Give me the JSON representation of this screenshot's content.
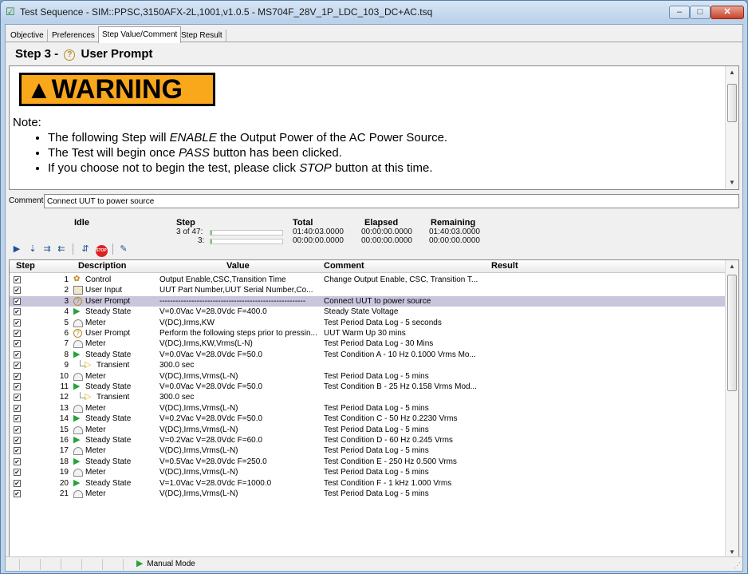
{
  "window": {
    "title": "Test Sequence - SIM::PPSC,3150AFX-2L,1001,v1.0.5 - MS704F_28V_1P_LDC_103_DC+AC.tsq",
    "app_icon": "checklist-icon",
    "buttons": {
      "minimize": "–",
      "maximize": "□",
      "close": "✕"
    }
  },
  "tabs": [
    {
      "label": "Objective"
    },
    {
      "label": "Preferences"
    },
    {
      "label": "Step Value/Comment",
      "active": true
    },
    {
      "label": "Step Result"
    }
  ],
  "step_heading": {
    "prefix": "Step 3 -",
    "label": "User Prompt",
    "icon": "question-icon"
  },
  "prompt": {
    "warning_text": "WARNING",
    "note_label": "Note:",
    "bullets": [
      {
        "pre": "The following Step will ",
        "em": "ENABLE",
        "post": " the Output Power of the AC Power Source."
      },
      {
        "pre": "The Test will begin once ",
        "em": "PASS",
        "post": " button has been clicked."
      },
      {
        "pre": "If you choose not to begin the test, please click ",
        "em": "STOP",
        "post": " button at this time."
      }
    ]
  },
  "comment": {
    "label": "Comment:",
    "value": "Connect UUT to power source"
  },
  "status": {
    "state": "Idle",
    "step_header": "Step",
    "total_header": "Total",
    "elapsed_header": "Elapsed",
    "remaining_header": "Remaining",
    "step_row1": "3 of 47:",
    "step_row2": "3:",
    "total_row1": "01:40:03.0000",
    "total_row2": "00:00:00.0000",
    "elapsed_row1": "00:00:00.0000",
    "elapsed_row2": "00:00:00.0000",
    "remaining_row1": "01:40:03.0000",
    "remaining_row2": "00:00:00.0000",
    "progress1": 0.02,
    "progress2": 0.02
  },
  "toolbar": [
    {
      "name": "run-icon",
      "glyph": "▶"
    },
    {
      "name": "step-into-icon",
      "glyph": "⇣"
    },
    {
      "name": "step-over-icon",
      "glyph": "⇉"
    },
    {
      "name": "step-out-icon",
      "glyph": "⇇"
    },
    {
      "name": "pause-icon",
      "glyph": "⇵"
    },
    {
      "name": "stop-icon",
      "glyph": "STOP"
    },
    {
      "name": "edit-icon",
      "glyph": "✎"
    }
  ],
  "grid": {
    "headers": {
      "step": "Step",
      "description": "Description",
      "value": "Value",
      "comment": "Comment",
      "result": "Result"
    },
    "rows": [
      {
        "n": "1",
        "icon": "control",
        "desc": "Control",
        "value": "Output Enable,CSC,Transition Time",
        "comment": "Change Output Enable, CSC, Transition T..."
      },
      {
        "n": "2",
        "icon": "input",
        "desc": "User Input",
        "value": "UUT Part Number,UUT Serial Number,Co...",
        "comment": ""
      },
      {
        "n": "3",
        "icon": "prompt",
        "desc": "User Prompt",
        "value": "-------------------------------------------------------",
        "comment": "Connect UUT to power source",
        "selected": true
      },
      {
        "n": "4",
        "icon": "steady",
        "desc": "Steady State",
        "value": "V=0.0Vac V=28.0Vdc F=400.0",
        "comment": "Steady State Voltage"
      },
      {
        "n": "5",
        "icon": "meter",
        "desc": "Meter",
        "value": "V(DC),Irms,KW",
        "comment": "Test Period Data Log - 5 seconds"
      },
      {
        "n": "6",
        "icon": "prompt",
        "desc": "User Prompt",
        "value": "Perform the following steps prior to pressin...",
        "comment": "UUT Warm Up 30 mins"
      },
      {
        "n": "7",
        "icon": "meter",
        "desc": "Meter",
        "value": "V(DC),Irms,KW,Vrms(L-N)",
        "comment": "Test Period Data Log - 30 Mins"
      },
      {
        "n": "8",
        "icon": "steady",
        "desc": "Steady State",
        "value": "V=0.0Vac V=28.0Vdc F=50.0",
        "comment": "Test Condition A - 10 Hz 0.1000 Vrms Mo..."
      },
      {
        "n": "9",
        "icon": "transient",
        "desc": "Transient",
        "value": "300.0 sec",
        "comment": ""
      },
      {
        "n": "10",
        "icon": "meter",
        "desc": "Meter",
        "value": "V(DC),Irms,Vrms(L-N)",
        "comment": "Test Period Data Log - 5 mins"
      },
      {
        "n": "11",
        "icon": "steady",
        "desc": "Steady State",
        "value": "V=0.0Vac V=28.0Vdc F=50.0",
        "comment": "Test Condition B - 25 Hz 0.158 Vrms Mod..."
      },
      {
        "n": "12",
        "icon": "transient",
        "desc": "Transient",
        "value": "300.0 sec",
        "comment": ""
      },
      {
        "n": "13",
        "icon": "meter",
        "desc": "Meter",
        "value": "V(DC),Irms,Vrms(L-N)",
        "comment": "Test Period Data Log - 5 mins"
      },
      {
        "n": "14",
        "icon": "steady",
        "desc": "Steady State",
        "value": "V=0.2Vac V=28.0Vdc F=50.0",
        "comment": "Test Condition C - 50 Hz 0.2230 Vrms"
      },
      {
        "n": "15",
        "icon": "meter",
        "desc": "Meter",
        "value": "V(DC),Irms,Vrms(L-N)",
        "comment": "Test Period Data Log - 5 mins"
      },
      {
        "n": "16",
        "icon": "steady",
        "desc": "Steady State",
        "value": "V=0.2Vac V=28.0Vdc F=60.0",
        "comment": "Test Condition D - 60 Hz 0.245 Vrms"
      },
      {
        "n": "17",
        "icon": "meter",
        "desc": "Meter",
        "value": "V(DC),Irms,Vrms(L-N)",
        "comment": "Test Period Data Log - 5 mins"
      },
      {
        "n": "18",
        "icon": "steady",
        "desc": "Steady State",
        "value": "V=0.5Vac V=28.0Vdc F=250.0",
        "comment": "Test Condition E - 250 Hz 0.500 Vrms"
      },
      {
        "n": "19",
        "icon": "meter",
        "desc": "Meter",
        "value": "V(DC),Irms,Vrms(L-N)",
        "comment": "Test Period Data Log - 5 mins"
      },
      {
        "n": "20",
        "icon": "steady",
        "desc": "Steady State",
        "value": "V=1.0Vac V=28.0Vdc F=1000.0",
        "comment": "Test Condition F - 1 kHz 1.000 Vrms"
      },
      {
        "n": "21",
        "icon": "meter",
        "desc": "Meter",
        "value": "V(DC),Irms,Vrms(L-N)",
        "comment": "Test Period Data Log - 5 mins"
      }
    ]
  },
  "statusbar": {
    "mode": "Manual Mode"
  },
  "colors": {
    "selected_row": "#cac5dd",
    "warning_bg": "#f9a71b",
    "play_green": "#27a13a",
    "stop_red": "#d22222"
  }
}
